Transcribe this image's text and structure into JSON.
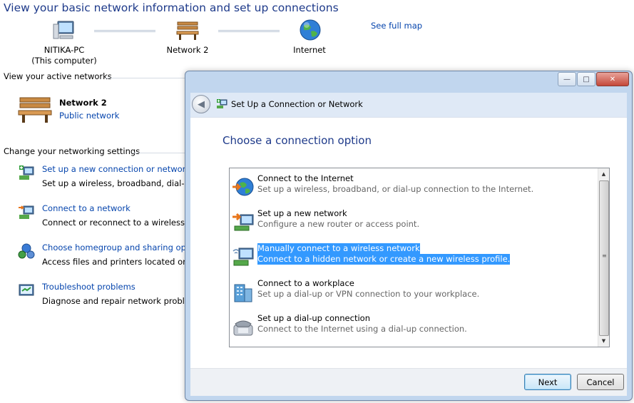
{
  "background": {
    "title": "View your basic network information and set up connections",
    "see_full_map": "See full map",
    "map": {
      "computer_name": "NITIKA-PC",
      "computer_sub": "(This computer)",
      "network": "Network  2",
      "internet": "Internet"
    },
    "active_networks_heading": "View your active networks",
    "active_network": {
      "name": "Network  2",
      "type": "Public network"
    },
    "change_settings_heading": "Change your networking settings",
    "settings": [
      {
        "title": "Set up a new connection or network",
        "desc": "Set up a wireless, broadband, dial-up,"
      },
      {
        "title": "Connect to a network",
        "desc": "Connect or reconnect to a wireless, wi"
      },
      {
        "title": "Choose homegroup and sharing optio",
        "desc": "Access files and printers located on ot"
      },
      {
        "title": "Troubleshoot problems",
        "desc": "Diagnose and repair network problem"
      }
    ]
  },
  "dialog": {
    "title": "Set Up a Connection or Network",
    "heading": "Choose a connection option",
    "options": [
      {
        "title": "Connect to the Internet",
        "desc": "Set up a wireless, broadband, or dial-up connection to the Internet.",
        "icon": "globe-icon"
      },
      {
        "title": "Set up a new network",
        "desc": "Configure a new router or access point.",
        "icon": "router-icon"
      },
      {
        "title": "Manually connect to a wireless network",
        "desc": "Connect to a hidden network or create a new wireless profile.",
        "icon": "wireless-computer-icon",
        "selected": true
      },
      {
        "title": "Connect to a workplace",
        "desc": "Set up a dial-up or VPN connection to your workplace.",
        "icon": "workplace-icon"
      },
      {
        "title": "Set up a dial-up connection",
        "desc": "Connect to the Internet using a dial-up connection.",
        "icon": "phone-icon"
      }
    ],
    "next_label": "Next",
    "cancel_label": "Cancel"
  },
  "colors": {
    "selection": "#3399ff",
    "link": "#0645ad",
    "heading": "#1e3a8a"
  }
}
